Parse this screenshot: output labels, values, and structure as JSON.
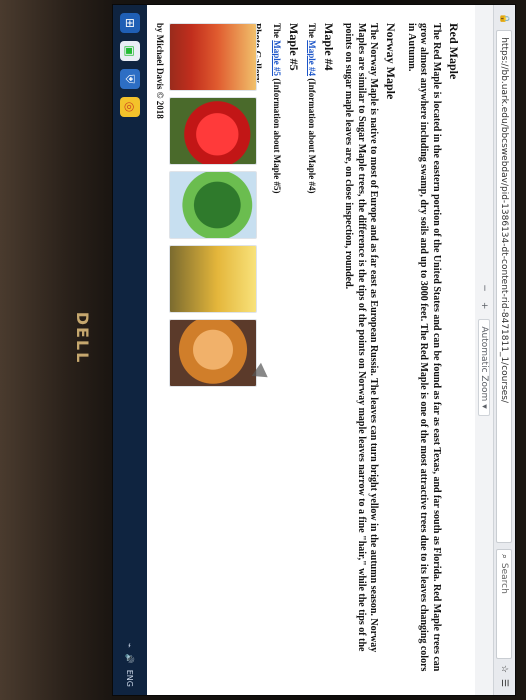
{
  "device": {
    "brand_text": "DELL"
  },
  "browser": {
    "url": "https://bb.uark.edu/bbcswebdav/pid-1386134-dt-content-rid-8471811_1/courses/",
    "search_placeholder": "Search",
    "toolbar": {
      "zoom_label": "Automatic Zoom",
      "plus": "+",
      "minus": "−"
    }
  },
  "content": {
    "heading_red": "Red Maple",
    "red_paragraph": "The Red Maple is located in the eastern portion of the United States and can be found as far as east Texas, and far south as Florida. Red Maple trees can grow almost anywhere including swamp, dry soils and up to 3000 feet. The Red Maple is one of the most attractive trees due to its leaves changing colors in Autumn.",
    "heading_norway": "Norway Maple",
    "norway_paragraph": "The Norway Maple is native to most of Europe and as far east as European Russia. The leaves can turn bright yellow in the autumn season. Norway Maples are similar to Sugar Maple trees, the difference is the tips of the points on Norway maple leaves narrow to a fine \"hair,\" while the tips of the points on sugar maple leaves are, on close inspection, rounded.",
    "heading_4": "Maple #4",
    "maple4_line_prefix": "The ",
    "maple4_link": "Maple #4",
    "maple4_line_suffix": " (Information about Maple #4)",
    "heading_5": "Maple #5",
    "maple5_line_prefix": "The ",
    "maple5_link": "Maple #5",
    "maple5_line_suffix": " (Information about Maple #5)",
    "gallery_title": "Photo Gallery",
    "byline": "by Michael Davis © 2018"
  },
  "taskbar": {
    "tray_text": "ENG"
  }
}
